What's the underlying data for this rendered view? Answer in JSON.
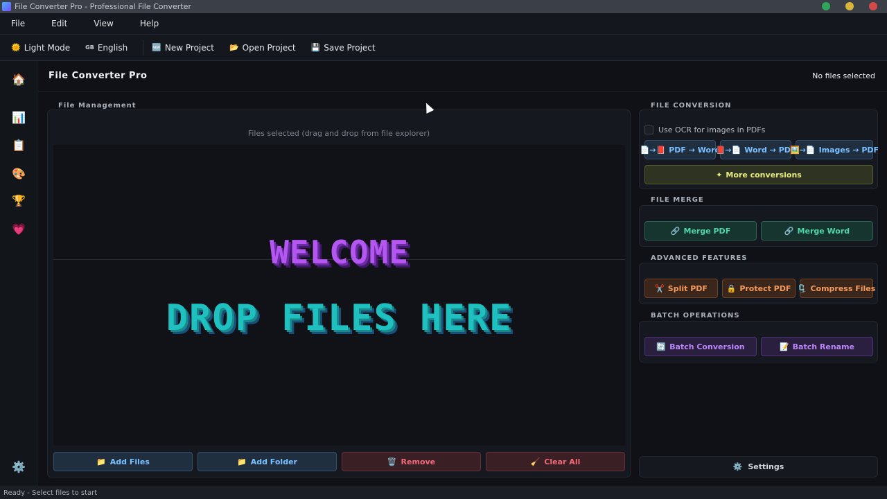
{
  "window": {
    "title": "File Converter Pro - Professional File Converter"
  },
  "menu": [
    "File",
    "Edit",
    "View",
    "Help"
  ],
  "toolbar": {
    "light_mode": {
      "icon": "sun-icon",
      "glyph": "🌞",
      "label": "Light Mode"
    },
    "language": {
      "flag": "GB",
      "label": "English"
    },
    "new_project": {
      "glyph": "🆕",
      "label": "New Project"
    },
    "open_project": {
      "glyph": "📂",
      "label": "Open Project"
    },
    "save_project": {
      "glyph": "💾",
      "label": "Save Project"
    }
  },
  "sidebar": {
    "items": [
      {
        "name": "home-icon",
        "glyph": "🏠"
      },
      {
        "name": "chart-icon",
        "glyph": "📊"
      },
      {
        "name": "clipboard-icon",
        "glyph": "📋"
      },
      {
        "name": "palette-icon",
        "glyph": "🎨"
      },
      {
        "name": "trophy-icon",
        "glyph": "🏆"
      },
      {
        "name": "heart-icon",
        "glyph": "💗"
      }
    ],
    "settings": {
      "name": "gear-icon",
      "glyph": "⚙️"
    }
  },
  "header": {
    "title": "File Converter Pro",
    "status": "No files selected"
  },
  "file_management": {
    "label": "File Management",
    "hint": "Files selected (drag and drop from file explorer)",
    "dropzone": {
      "line1": "WELCOME",
      "line2": "DROP FILES HERE"
    },
    "buttons": {
      "add_files": {
        "glyph": "📁",
        "label": "Add Files"
      },
      "add_folder": {
        "glyph": "📁",
        "label": "Add Folder"
      },
      "remove": {
        "glyph": "🗑️",
        "label": "Remove"
      },
      "clear_all": {
        "glyph": "🧹",
        "label": "Clear All"
      }
    }
  },
  "file_conversion": {
    "label": "FILE CONVERSION",
    "ocr_label": "Use OCR for images in PDFs",
    "ocr_checked": false,
    "buttons": {
      "pdf_to_word": {
        "glyph": "📄→📕",
        "label": "PDF → Word"
      },
      "word_to_pdf": {
        "glyph": "📕→📄",
        "label": "Word → PDF"
      },
      "images_to_pdf": {
        "glyph": "🖼️→📄",
        "label": "Images → PDF"
      },
      "more": {
        "glyph": "✦",
        "label": "More conversions"
      }
    }
  },
  "file_merge": {
    "label": "FILE MERGE",
    "buttons": {
      "merge_pdf": {
        "glyph": "🔗",
        "label": "Merge PDF"
      },
      "merge_word": {
        "glyph": "🔗",
        "label": "Merge Word"
      }
    }
  },
  "advanced": {
    "label": "ADVANCED FEATURES",
    "buttons": {
      "split_pdf": {
        "glyph": "✂️",
        "label": "Split PDF"
      },
      "protect_pdf": {
        "glyph": "🔒",
        "label": "Protect PDF"
      },
      "compress": {
        "glyph": "🗜️",
        "label": "Compress Files"
      }
    }
  },
  "batch": {
    "label": "BATCH OPERATIONS",
    "buttons": {
      "batch_conversion": {
        "glyph": "🔄",
        "label": "Batch Conversion"
      },
      "batch_rename": {
        "glyph": "📝",
        "label": "Batch Rename"
      }
    }
  },
  "settings": {
    "glyph": "⚙️",
    "label": "Settings"
  },
  "statusbar": {
    "text": "Ready - Select files to start"
  }
}
